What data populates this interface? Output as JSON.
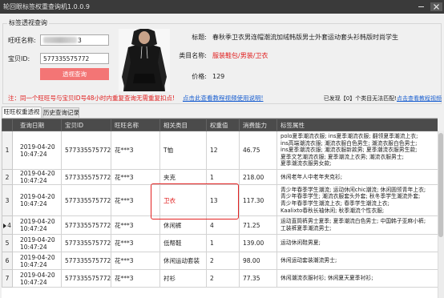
{
  "window": {
    "title": "轮回眼标签权重查询机1.0.0.9"
  },
  "query_group": {
    "legend": "标签透视查询",
    "wangwang_label": "旺旺名称:",
    "wangwang_value": "3",
    "item_id_label": "宝贝ID:",
    "item_id_value": "577335575772",
    "query_button": "透视查询"
  },
  "product": {
    "title_label": "标题:",
    "title": "春秋季卫衣男连帽潮流加绒韩版男士外套运动套头衫韩版时尚学生",
    "category_label": "类目名称:",
    "category": "服装鞋包/男装/卫衣",
    "price_label": "价格:",
    "price": "129"
  },
  "notice": {
    "text": "注：同一个旺旺号与宝贝ID号48小时内重复查询无需重复扣点!",
    "tutorial_link": "点击此查看教程视频使用说明!",
    "unmatched_text": "已发现【0】个类目无法匹配!",
    "unmatched_link": "点击查看教程视频"
  },
  "tabs": [
    {
      "label": "旺旺权重透视",
      "active": true
    },
    {
      "label": "历史查询记录",
      "active": false
    }
  ],
  "table": {
    "columns": [
      "查询日期",
      "宝贝ID",
      "旺旺名称",
      "相关类目",
      "权重值",
      "消费能力",
      "标签属性"
    ],
    "rows": [
      {
        "index": "1",
        "date": "2019-04-20",
        "time": "10:47:24",
        "item_id": "577335575772",
        "wangwang": "花***3",
        "category": "T恤",
        "weight": "12",
        "consumption": "46.75",
        "tags": [
          "polo夏季潮流衣服; ins夏季潮流衣服; 翻领夏季潮流上衣;",
          "ins高端潮流衣服; 潮流衣服白色男生; 潮流衣服白色男士;",
          "ins夏季潮流衣服; 潮流衣服新款男; 夏季潮流衣服男生款;",
          "夏季文艺潮流衣服; 夏季潮流上衣男; 潮流衣服男士;",
          "夏季潮流衣服男女款;"
        ]
      },
      {
        "index": "2",
        "date": "2019-04-20",
        "time": "10:47:24",
        "item_id": "577335575772",
        "wangwang": "花***3",
        "category": "夹克",
        "weight": "1",
        "consumption": "218.00",
        "tags": [
          "休闲老年人中老年夹克衫;"
        ]
      },
      {
        "index": "3",
        "date": "2019-04-20",
        "time": "10:47:24",
        "item_id": "577335575772",
        "wangwang": "花***3",
        "category": "卫衣",
        "weight": "13",
        "consumption": "117.30",
        "highlight": true,
        "tags": [
          "青少年春季学生潮流; 运动休闲chic潮流; 休闲圆领青年上衣;",
          "青少年春季学生; 潮流衣服套头外套; 秋冬季学生潮流外套;",
          "青少年春季学生潮流上衣; 春季学生潮流上衣;",
          "Kaalixto春秋长袖休闲; 秋季潮流个性衣服;"
        ]
      },
      {
        "index": "4",
        "date": "2019-04-20",
        "time": "10:47:24",
        "item_id": "577335575772",
        "wangwang": "花***3",
        "category": "休闲裤",
        "weight": "4",
        "consumption": "71.25",
        "current": true,
        "tags": [
          "运动直筒裤男士夏季; 夏季潮流白色男士; 中国韩子亚麻小裤;",
          "工装裤夏季潮流男士;"
        ]
      },
      {
        "index": "5",
        "date": "2019-04-20",
        "time": "10:47:24",
        "item_id": "577335575772",
        "wangwang": "花***3",
        "category": "低帮鞋",
        "weight": "1",
        "consumption": "139.00",
        "tags": [
          "运动休闲鞋男夏;"
        ]
      },
      {
        "index": "6",
        "date": "2019-04-20",
        "time": "10:47:24",
        "item_id": "577335575772",
        "wangwang": "花***3",
        "category": "休闲运动套装",
        "weight": "2",
        "consumption": "98.00",
        "tags": [
          "休闲运动套装潮流男士;"
        ]
      },
      {
        "index": "7",
        "date": "2019-04-20",
        "time": "10:47:24",
        "item_id": "577335575772",
        "wangwang": "花***3",
        "category": "衬衫",
        "weight": "2",
        "consumption": "77.35",
        "tags": [
          "休闲潮流衣服衬衫; 休闲夏天夏季衬衫;"
        ]
      }
    ]
  },
  "icons": {
    "minimize": "minimize-icon",
    "close": "close-icon",
    "row_pointer": "row-pointer-icon",
    "product_photo": "hoodie-photo"
  },
  "colors": {
    "titlebar": "#3a3a3a",
    "window_bg": "#f0f0f0",
    "query_button": "#f37575",
    "notice_red": "#e01a1a",
    "link_blue": "#1a5fd0",
    "header_bg": "#4b4b4b",
    "highlight_border": "#e32222",
    "category_red": "#e01a1a"
  }
}
